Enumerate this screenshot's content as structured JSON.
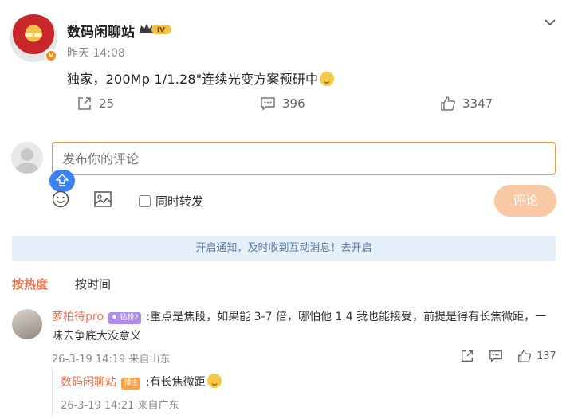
{
  "post": {
    "username": "数码闲聊站",
    "badge_level": "IV",
    "time": "昨天 14:08",
    "text": "独家，200Mp 1/1.28\"连续光变方案预研中",
    "reposts": "25",
    "comments": "396",
    "likes": "3347",
    "v_mark": "v"
  },
  "composer": {
    "placeholder": "发布你的评论",
    "repost_label": "同时转发",
    "submit_label": "评论"
  },
  "notice": {
    "text": "开启通知，及时收到互动消息！去开启"
  },
  "sort_tabs": [
    {
      "label": "按热度",
      "active": true
    },
    {
      "label": "按时间",
      "active": false
    }
  ],
  "comment": {
    "name": "萝柏待pro",
    "level": "钻粉2",
    "text": ":重点是焦段，如果能 3-7 倍，哪怕他 1.4 我也能接受，前提是得有长焦微距，一味去争底大没意义",
    "meta": "26-3-19 14:19 来自山东",
    "likes": "137"
  },
  "reply": {
    "name": "数码闲聊站",
    "badge": "博主",
    "text": ":有长焦微距",
    "meta": "26-3-19 14:21 来自广东"
  },
  "colors": {
    "accent": "#eb7350",
    "input_border": "#f09a47",
    "notice_bg": "#e5f0fb",
    "submit_bg": "#f9c9a6"
  },
  "icons": {
    "chevron": "chevron-down-icon",
    "repost": "repost-icon",
    "comment": "comment-icon",
    "like": "like-icon",
    "emoji": "emoji-icon",
    "image": "image-icon",
    "upload": "upload-icon"
  }
}
